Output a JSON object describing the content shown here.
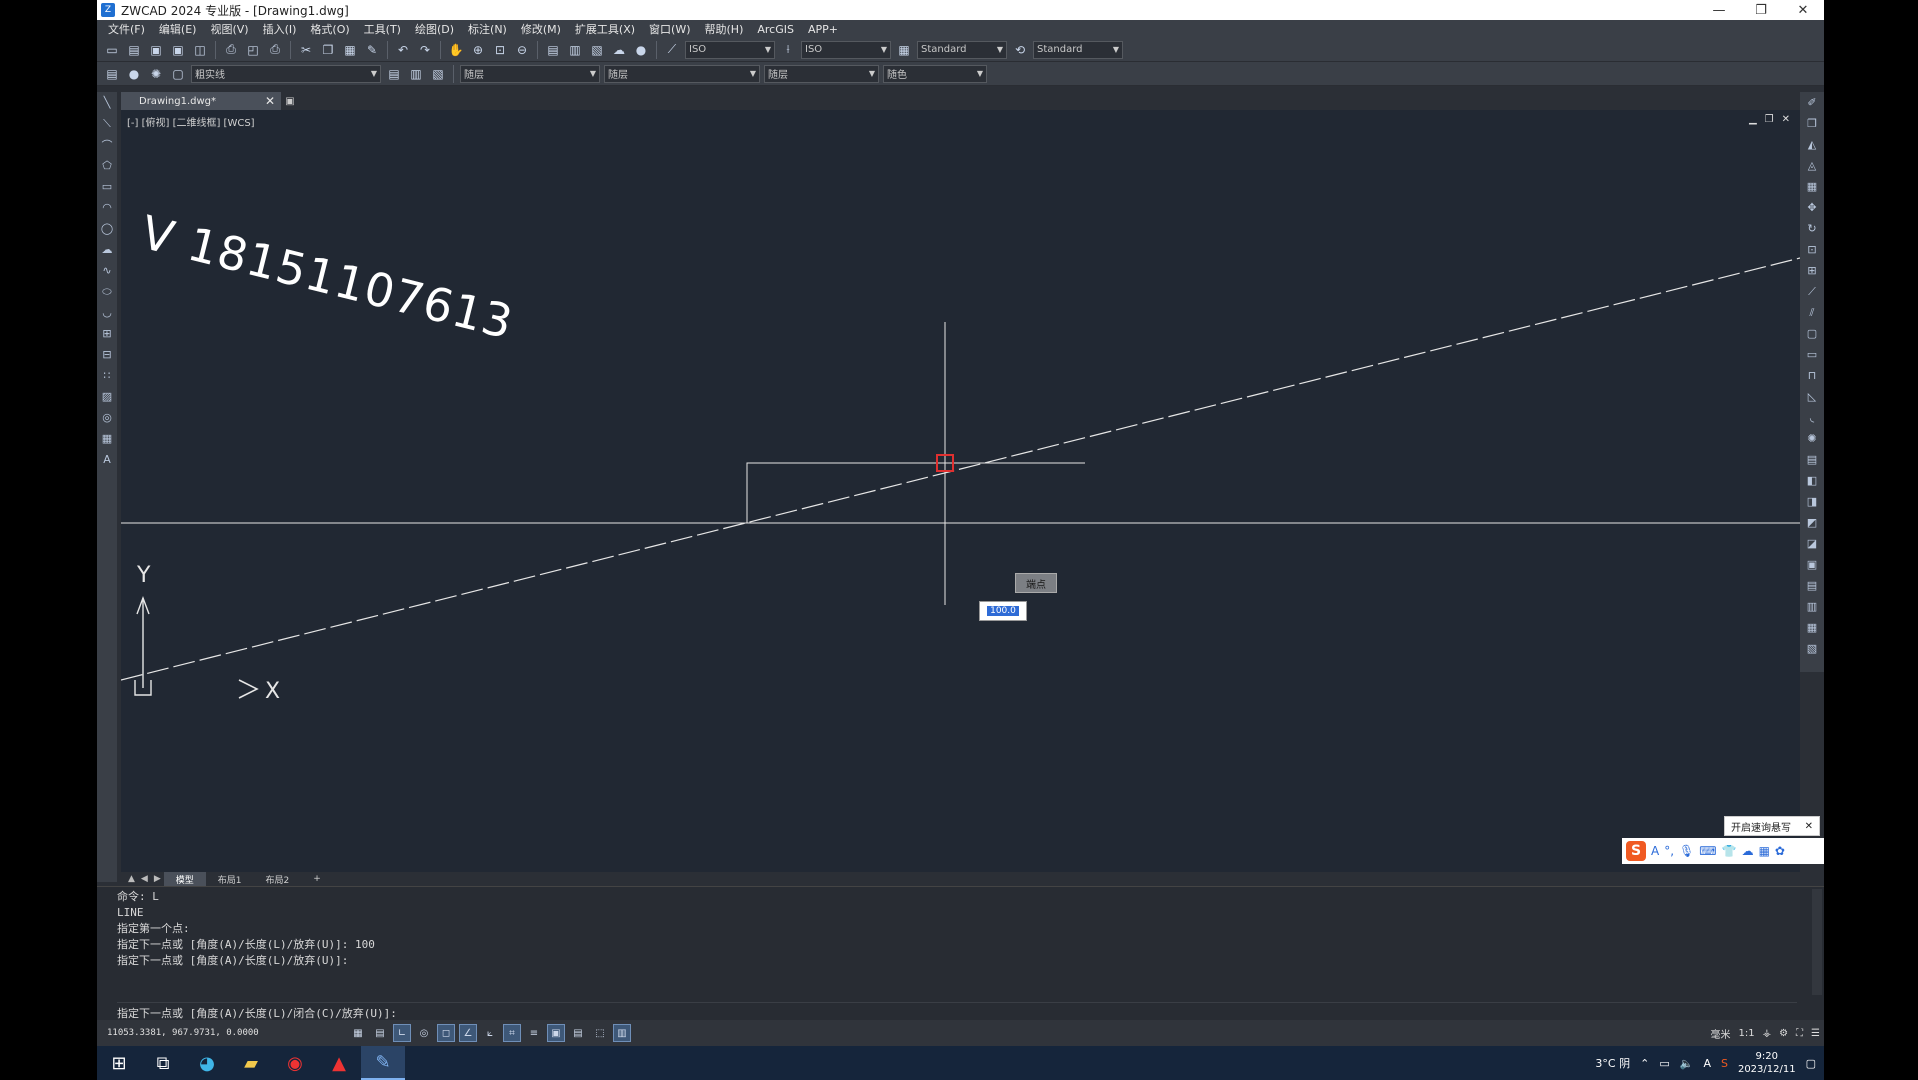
{
  "window": {
    "title": "ZWCAD 2024 专业版 - [Drawing1.dwg]",
    "minimize": "—",
    "restore": "❐",
    "close": "✕"
  },
  "menu": [
    "文件(F)",
    "编辑(E)",
    "视图(V)",
    "插入(I)",
    "格式(O)",
    "工具(T)",
    "绘图(D)",
    "标注(N)",
    "修改(M)",
    "扩展工具(X)",
    "窗口(W)",
    "帮助(H)",
    "ArcGIS",
    "APP+"
  ],
  "toolbar1": {
    "dim_style": "ISO",
    "dim_style2": "ISO",
    "text_style": "Standard",
    "table_style": "Standard"
  },
  "toolbar2": {
    "layer": "粗实线",
    "color": "随层",
    "linetype": "随层",
    "lineweight": "随层",
    "plotstyle": "随色"
  },
  "doc_tab": {
    "label": "Drawing1.dwg*",
    "close": "✕"
  },
  "viewport": {
    "label": "[-] [俯视] [二维线框] [WCS]"
  },
  "watermark": "V 18151107613",
  "snap_tip": "端点",
  "dynamic_input": "100.0",
  "ucs": {
    "y": "Y",
    "x": "X"
  },
  "layout_tabs": [
    "模型",
    "布局1",
    "布局2",
    "+"
  ],
  "command": {
    "history": [
      "命令: L",
      "LINE",
      "指定第一个点:",
      "指定下一点或 [角度(A)/长度(L)/放弃(U)]: 100",
      "指定下一点或 [角度(A)/长度(L)/放弃(U)]:"
    ],
    "prompt": "指定下一点或 [角度(A)/长度(L)/闭合(C)/放弃(U)]:"
  },
  "status": {
    "coords": "11053.3381, 967.9731, 0.0000",
    "unit": "毫米",
    "scale": "1:1"
  },
  "ime": {
    "tip": "开启速询悬写",
    "close": "✕"
  },
  "tray": {
    "weather": "3°C 阴",
    "time": "9:20",
    "date": "2023/12/11",
    "lang": "A"
  },
  "colors": {
    "canvas_bg": "#212833",
    "ui_bg": "#3a3f47",
    "taskbar": "#15253b",
    "snap_marker": "#e03030"
  }
}
